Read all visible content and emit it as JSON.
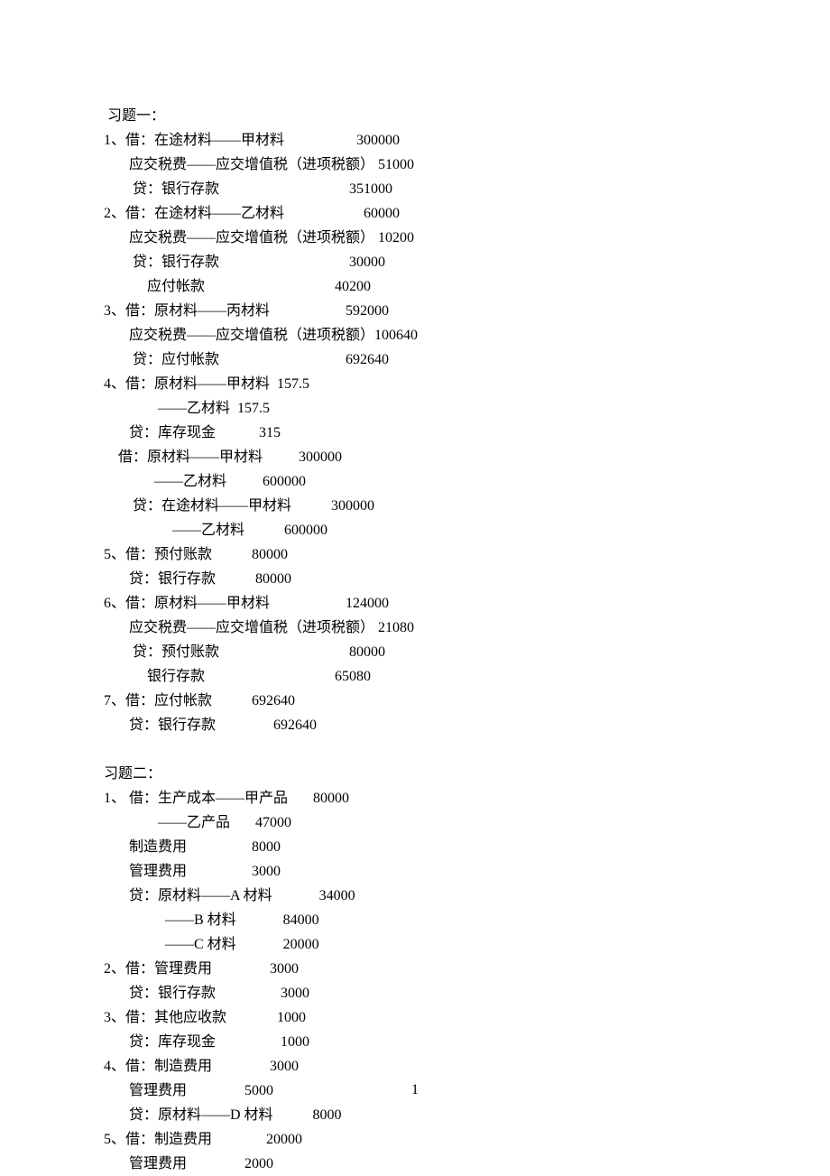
{
  "pageNumber": "1",
  "sections": [
    {
      "title": " 习题一：",
      "lines": [
        "1、借：在途材料——甲材料                    300000",
        "       应交税费——应交增值税（进项税额） 51000",
        "        贷：银行存款                                    351000",
        "2、借：在途材料——乙材料                      60000",
        "       应交税费——应交增值税（进项税额） 10200",
        "        贷：银行存款                                    30000",
        "            应付帐款                                    40200",
        "3、借：原材料——丙材料                     592000",
        "       应交税费——应交增值税（进项税额）100640",
        "        贷：应付帐款                                   692640",
        "4、借：原材料——甲材料  157.5",
        "               ——乙材料  157.5",
        "       贷：库存现金            315",
        "    借：原材料——甲材料          300000",
        "              ——乙材料          600000",
        "        贷：在途材料——甲材料           300000",
        "                   ——乙材料           600000",
        "5、借：预付账款           80000",
        "       贷：银行存款           80000",
        "6、借：原材料——甲材料                     124000",
        "       应交税费——应交增值税（进项税额） 21080",
        "        贷：预付账款                                    80000",
        "            银行存款                                    65080",
        "7、借：应付帐款           692640",
        "       贷：银行存款                692640"
      ]
    },
    {
      "title": "习题二：",
      "lines": [
        "1、 借：生产成本——甲产品       80000",
        "               ——乙产品       47000",
        "       制造费用                  8000",
        "       管理费用                  3000",
        "       贷：原材料——A 材料             34000",
        "                 ——B 材料             84000",
        "                 ——C 材料             20000",
        "2、借：管理费用                3000",
        "       贷：银行存款                  3000",
        "3、借：其他应收款              1000",
        "       贷：库存现金                  1000",
        "4、借：制造费用                3000",
        "       管理费用                5000",
        "       贷：原材料——D 材料           8000",
        "5、借：制造费用               20000",
        "       管理费用                2000"
      ]
    }
  ]
}
